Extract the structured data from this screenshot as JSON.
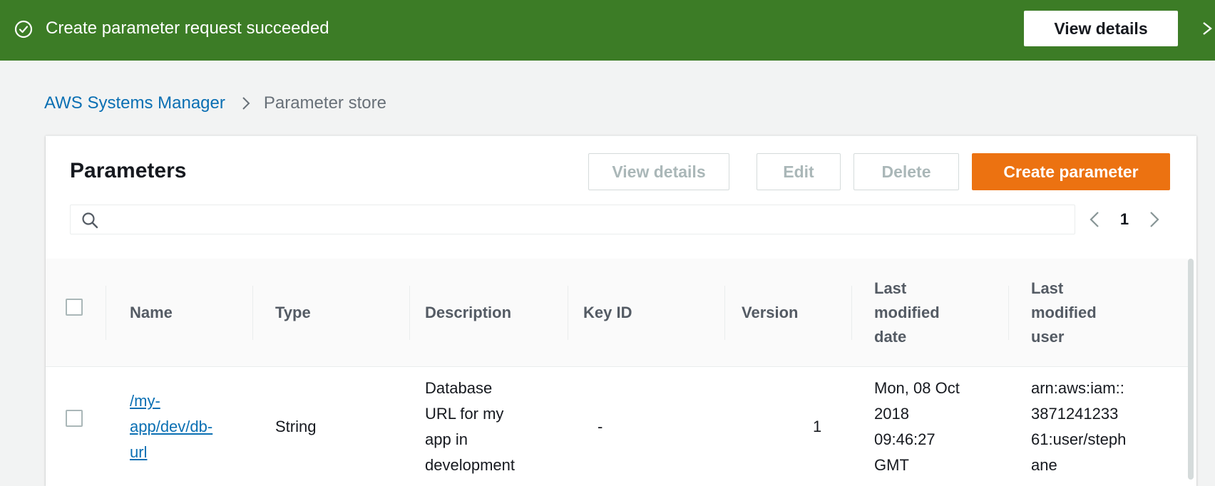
{
  "flash": {
    "message": "Create parameter request succeeded",
    "view_details_label": "View details",
    "icon": "check-circle-icon",
    "background": "#3c7c26"
  },
  "breadcrumb": {
    "items": [
      "AWS Systems Manager",
      "Parameter store"
    ]
  },
  "panel": {
    "title": "Parameters",
    "buttons": {
      "view_details": "View details",
      "edit": "Edit",
      "delete": "Delete",
      "create": "Create parameter"
    },
    "search": {
      "value": "",
      "placeholder": ""
    },
    "pagination": {
      "page": "1"
    }
  },
  "table": {
    "columns": [
      "Name",
      "Type",
      "Description",
      "Key ID",
      "Version",
      "Last\nmodified\ndate",
      "Last\nmodified\nuser"
    ],
    "rows": [
      {
        "name": "/my-\napp/dev/db-\nurl",
        "type": "String",
        "description": "Database\nURL for my\napp in\ndevelopment",
        "key_id": "-",
        "version": "1",
        "last_modified_date": "Mon, 08 Oct\n2018\n09:46:27\nGMT",
        "last_modified_user": "arn:aws:iam::\n3871241233\n61:user/steph\nane"
      }
    ]
  },
  "colors": {
    "accent": "#ec7211",
    "link": "#0a6fb3",
    "success": "#3c7c26"
  }
}
